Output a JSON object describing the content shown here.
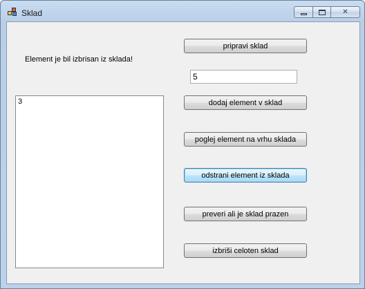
{
  "window": {
    "title": "Sklad",
    "controls": {
      "minimize": "minimize-icon",
      "maximize": "maximize-icon",
      "close": "close-icon"
    }
  },
  "form": {
    "status_message": "Element je bil izbrisan iz sklada!",
    "input_value": "5",
    "stack_items": [
      "3"
    ],
    "buttons": {
      "create": "pripravi sklad",
      "push": "dodaj element v sklad",
      "peek": "poglej element na vrhu sklada",
      "pop": "odstrani element iz sklada",
      "is_empty": "preveri ali je sklad prazen",
      "clear": "izbriši celoten sklad"
    }
  }
}
